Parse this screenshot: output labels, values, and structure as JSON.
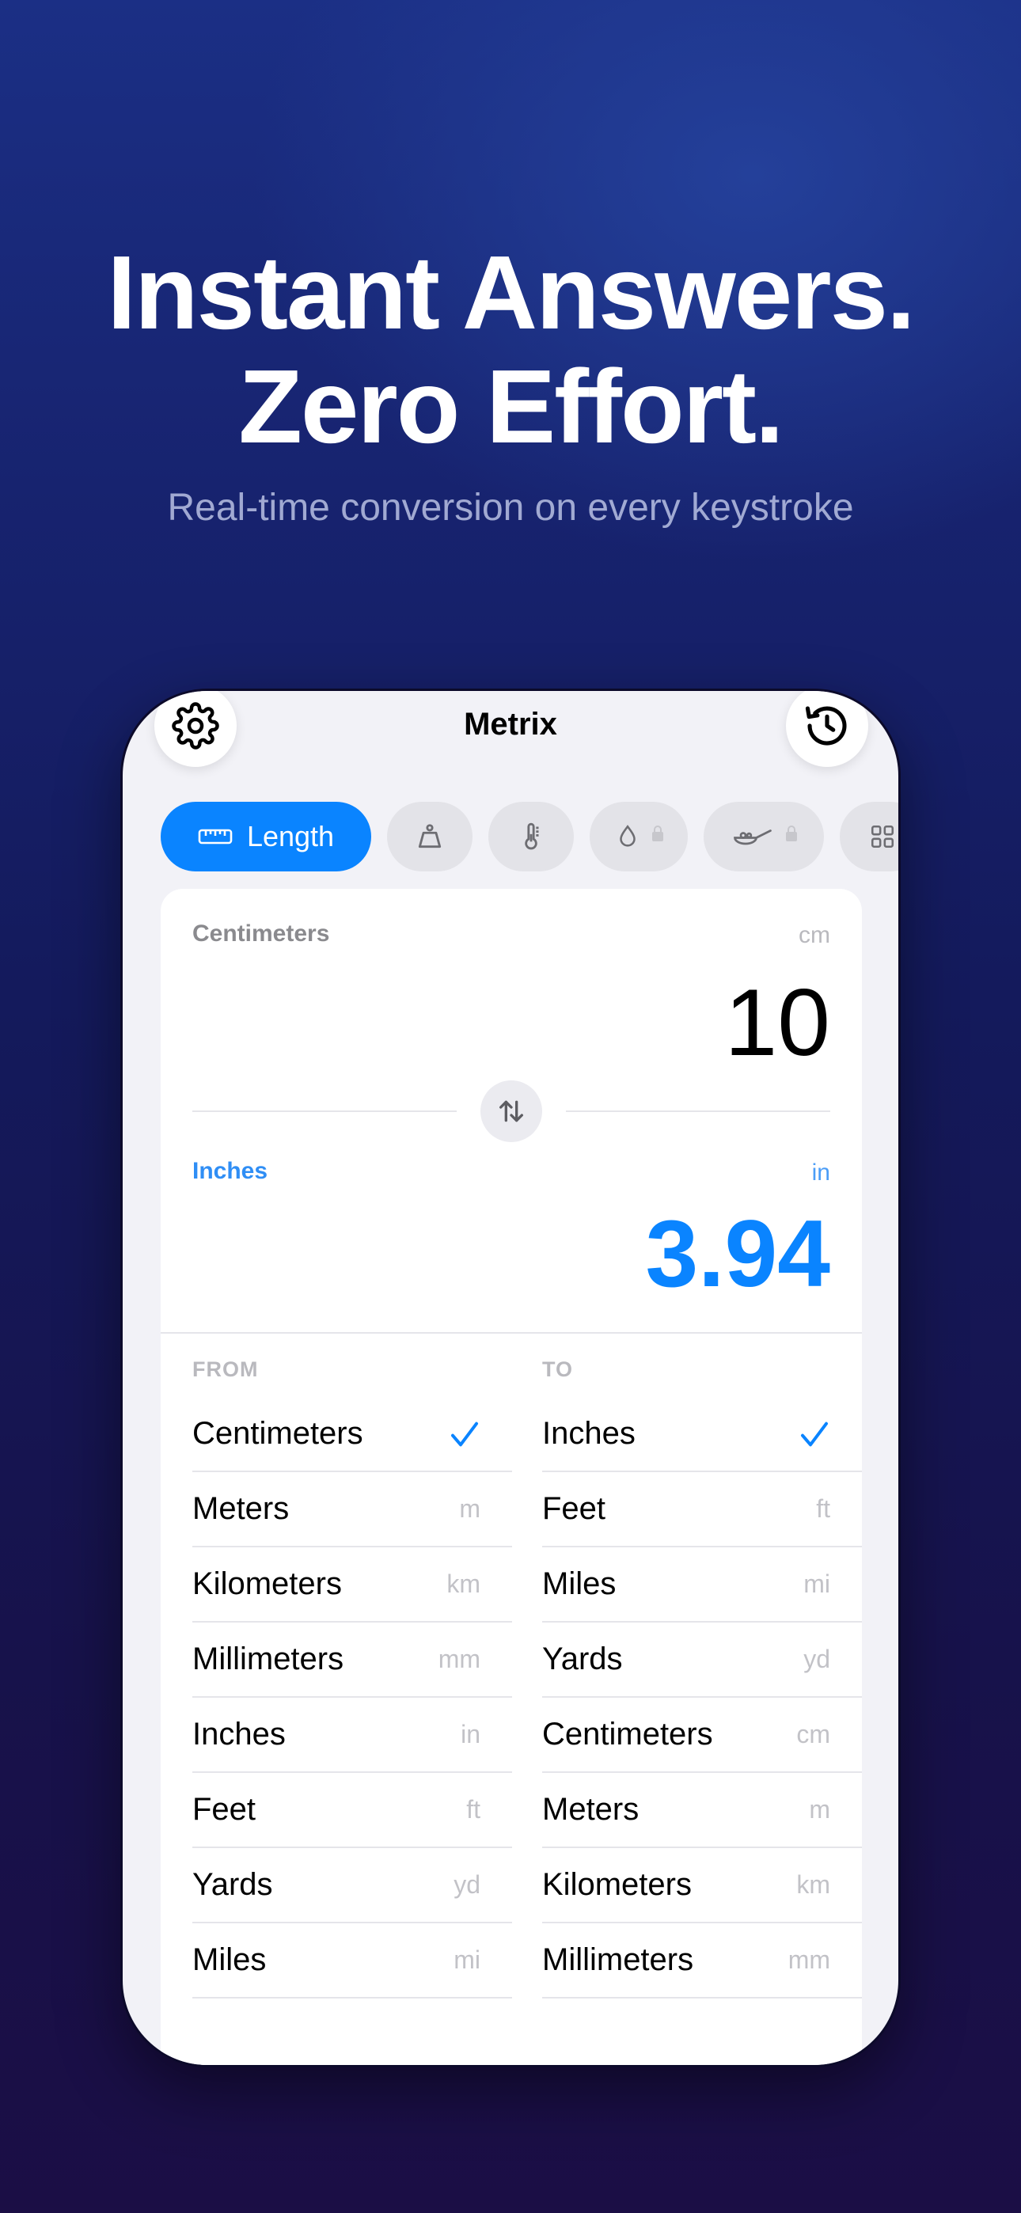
{
  "headline": {
    "line1": "Instant Answers.",
    "line2": "Zero Effort."
  },
  "subhead": "Real-time conversion on every keystroke",
  "app": {
    "title": "Metrix",
    "categories": [
      {
        "label": "Length",
        "icon": "ruler-icon",
        "active": true
      },
      {
        "label": "",
        "icon": "weight-icon",
        "active": false
      },
      {
        "label": "",
        "icon": "thermometer-icon",
        "active": false
      },
      {
        "label": "",
        "icon": "drop-icon",
        "locked": true
      },
      {
        "label": "",
        "icon": "pan-icon",
        "locked": true
      },
      {
        "label": "",
        "icon": "grid-icon",
        "active": false
      }
    ],
    "from": {
      "label": "Centimeters",
      "unit": "cm",
      "value": "10"
    },
    "to": {
      "label": "Inches",
      "unit": "in",
      "value": "3.94"
    },
    "from_list": {
      "header": "FROM",
      "items": [
        {
          "name": "Centimeters",
          "abbr": "",
          "selected": true
        },
        {
          "name": "Meters",
          "abbr": "m"
        },
        {
          "name": "Kilometers",
          "abbr": "km"
        },
        {
          "name": "Millimeters",
          "abbr": "mm"
        },
        {
          "name": "Inches",
          "abbr": "in"
        },
        {
          "name": "Feet",
          "abbr": "ft"
        },
        {
          "name": "Yards",
          "abbr": "yd"
        },
        {
          "name": "Miles",
          "abbr": "mi"
        }
      ]
    },
    "to_list": {
      "header": "TO",
      "items": [
        {
          "name": "Inches",
          "abbr": "",
          "selected": true
        },
        {
          "name": "Feet",
          "abbr": "ft"
        },
        {
          "name": "Miles",
          "abbr": "mi"
        },
        {
          "name": "Yards",
          "abbr": "yd"
        },
        {
          "name": "Centimeters",
          "abbr": "cm"
        },
        {
          "name": "Meters",
          "abbr": "m"
        },
        {
          "name": "Kilometers",
          "abbr": "km"
        },
        {
          "name": "Millimeters",
          "abbr": "mm"
        }
      ]
    },
    "colors": {
      "accent": "#0a84ff",
      "background": "#f2f2f7"
    }
  }
}
